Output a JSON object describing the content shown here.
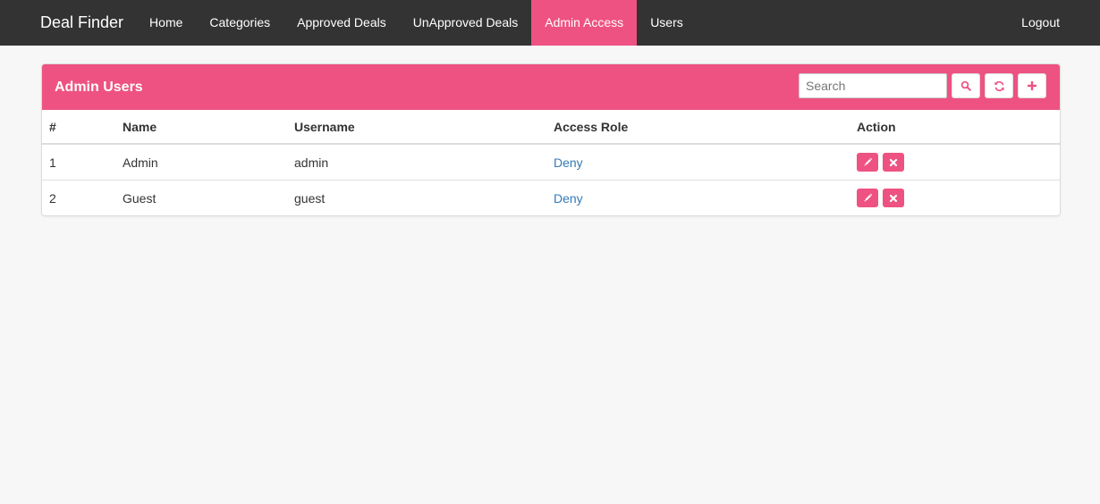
{
  "app": {
    "brand": "Deal Finder"
  },
  "nav": {
    "items": [
      {
        "label": "Home"
      },
      {
        "label": "Categories"
      },
      {
        "label": "Approved Deals"
      },
      {
        "label": "UnApproved Deals"
      },
      {
        "label": "Admin Access"
      },
      {
        "label": "Users"
      }
    ],
    "active_index": 4,
    "logout": "Logout"
  },
  "panel": {
    "title": "Admin Users",
    "search_placeholder": "Search",
    "toolbar_icons": [
      "search-icon",
      "refresh-icon",
      "plus-icon"
    ]
  },
  "table": {
    "headers": [
      "#",
      "Name",
      "Username",
      "Access Role",
      "Action"
    ],
    "rows": [
      {
        "num": "1",
        "name": "Admin",
        "username": "admin",
        "role": "Deny"
      },
      {
        "num": "2",
        "name": "Guest",
        "username": "guest",
        "role": "Deny"
      }
    ],
    "row_action_icons": [
      "pencil-icon",
      "close-icon"
    ]
  },
  "colors": {
    "accent": "#ee5282",
    "navbar": "#333333",
    "link": "#337ab7",
    "background": "#f7f7f7"
  }
}
